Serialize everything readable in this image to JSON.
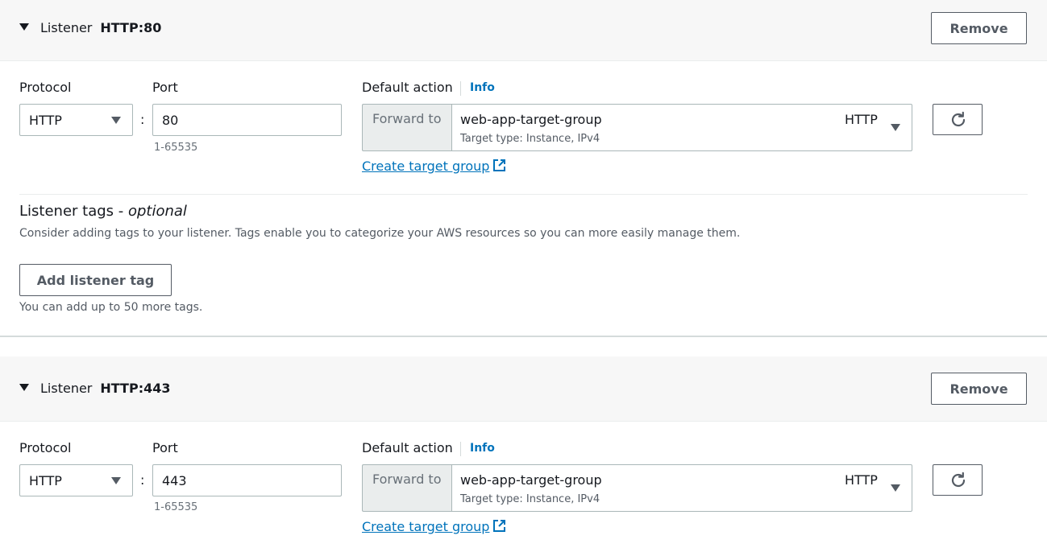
{
  "listeners": [
    {
      "title_prefix": "Listener",
      "title_value": "HTTP:80",
      "remove_label": "Remove",
      "protocol_label": "Protocol",
      "protocol_value": "HTTP",
      "port_label": "Port",
      "port_value": "80",
      "port_hint": "1-65535",
      "colon": ":",
      "default_action_label": "Default action",
      "info_label": "Info",
      "forward_to_label": "Forward to",
      "target_group_name": "web-app-target-group",
      "target_group_type": "Target type: Instance, IPv4",
      "target_group_protocol": "HTTP",
      "create_target_group_label": "Create target group"
    },
    {
      "title_prefix": "Listener",
      "title_value": "HTTP:443",
      "remove_label": "Remove",
      "protocol_label": "Protocol",
      "protocol_value": "HTTP",
      "port_label": "Port",
      "port_value": "443",
      "port_hint": "1-65535",
      "colon": ":",
      "default_action_label": "Default action",
      "info_label": "Info",
      "forward_to_label": "Forward to",
      "target_group_name": "web-app-target-group",
      "target_group_type": "Target type: Instance, IPv4",
      "target_group_protocol": "HTTP",
      "create_target_group_label": "Create target group"
    }
  ],
  "tags": {
    "title": "Listener tags - ",
    "title_optional": "optional",
    "description": "Consider adding tags to your listener. Tags enable you to categorize your AWS resources so you can more easily manage them.",
    "add_button": "Add listener tag",
    "hint": "You can add up to 50 more tags."
  },
  "colors": {
    "link": "#0073bb",
    "header_bg": "#f7f7f7",
    "border": "#aab7b8",
    "text": "#16191f"
  },
  "icons": {
    "collapse": "caret-down-icon",
    "refresh": "refresh-icon",
    "external": "external-link-icon",
    "dropdown": "dropdown-arrow-icon"
  }
}
